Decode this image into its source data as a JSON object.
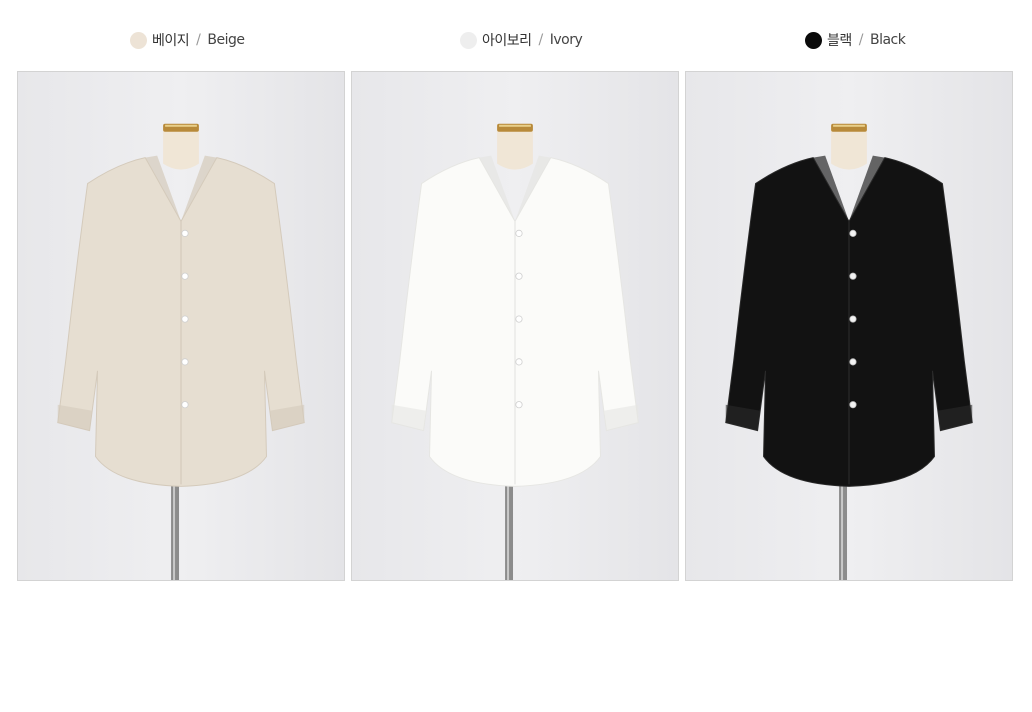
{
  "colors": [
    {
      "ko": "베이지",
      "sep": "/",
      "en": "Beige",
      "swatch": "#ede3d6",
      "garment": "#e6ded1",
      "shade": "#d4cabb"
    },
    {
      "ko": "아이보리",
      "sep": "/",
      "en": "Ivory",
      "swatch": "#eeeeee",
      "garment": "#fbfbf9",
      "shade": "#e6e6e3"
    },
    {
      "ko": "블랙",
      "sep": "/",
      "en": "Black",
      "swatch": "#0a0a0a",
      "garment": "#121212",
      "shade": "#2a2a2a"
    }
  ],
  "icons": {
    "photo": "blouse-on-mannequin-photo",
    "swatch": "color-swatch-icon"
  }
}
